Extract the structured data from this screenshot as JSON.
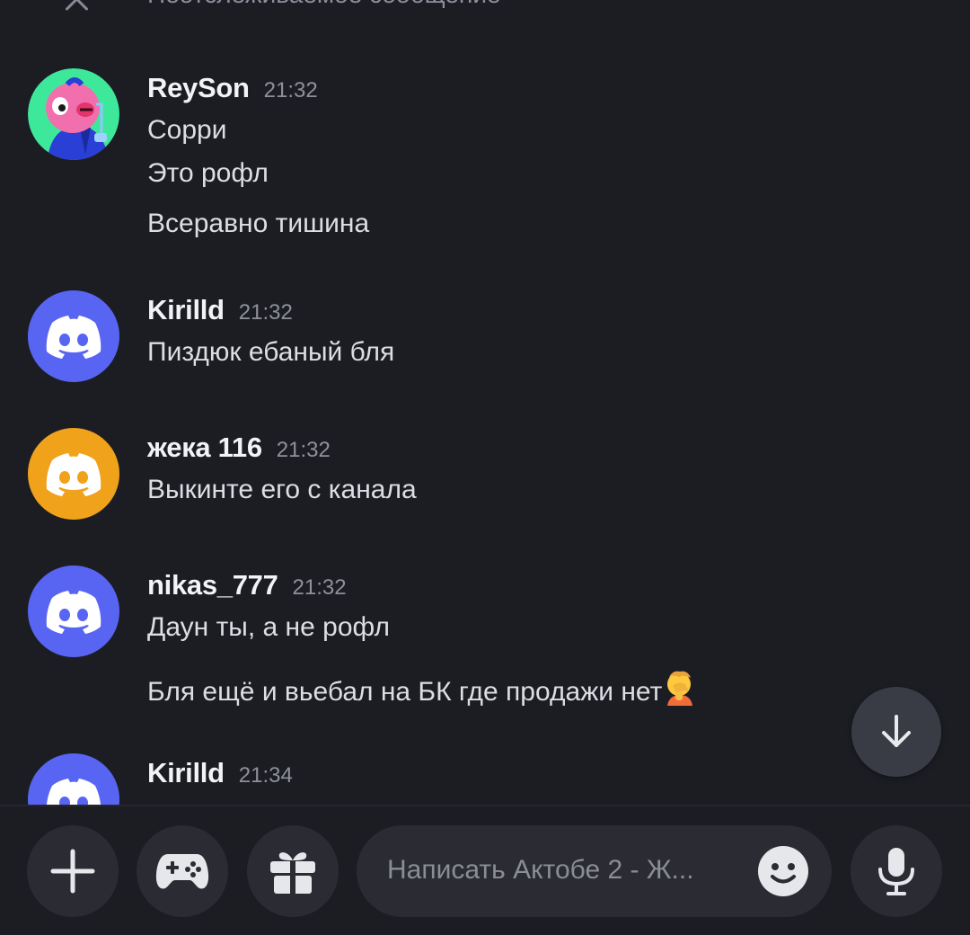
{
  "top_bar": {
    "label": "Неотслеживаемое сообщение"
  },
  "messages": [
    {
      "username": "ReySon",
      "time": "21:32",
      "lines": [
        "Сорри",
        "Это рофл",
        "Всеравно тишина"
      ],
      "avatar": "pink-character-avatar"
    },
    {
      "username": "Kirilld",
      "time": "21:32",
      "lines": [
        "Пиздюк ебаный бля"
      ],
      "avatar": "discord-default-avatar",
      "avatar_color": "#5865f2"
    },
    {
      "username": "жека 116",
      "time": "21:32",
      "lines": [
        "Выкинте его с канала"
      ],
      "avatar": "discord-default-avatar",
      "avatar_color": "#f0a21a"
    },
    {
      "username": "nikas_777",
      "time": "21:32",
      "lines": [
        "Даун ты, а не рофл",
        "Бля ещё и вьебал на БК где продажи нет"
      ],
      "avatar": "discord-default-avatar",
      "avatar_color": "#5865f2",
      "trailing_emoji": "facepalm-emoji"
    },
    {
      "username": "Kirilld",
      "time": "21:34",
      "lines": [],
      "avatar": "discord-default-avatar",
      "avatar_color": "#5865f2"
    }
  ],
  "composer": {
    "placeholder": "Написать Актобе 2 - Ж...",
    "buttons": [
      "plus-icon",
      "gamepad-icon",
      "gift-icon",
      "emoji-icon",
      "microphone-icon"
    ]
  },
  "colors": {
    "background": "#1c1d23",
    "button_bg": "#2b2c33",
    "blurple": "#5865f2",
    "orange": "#f0a21a"
  }
}
